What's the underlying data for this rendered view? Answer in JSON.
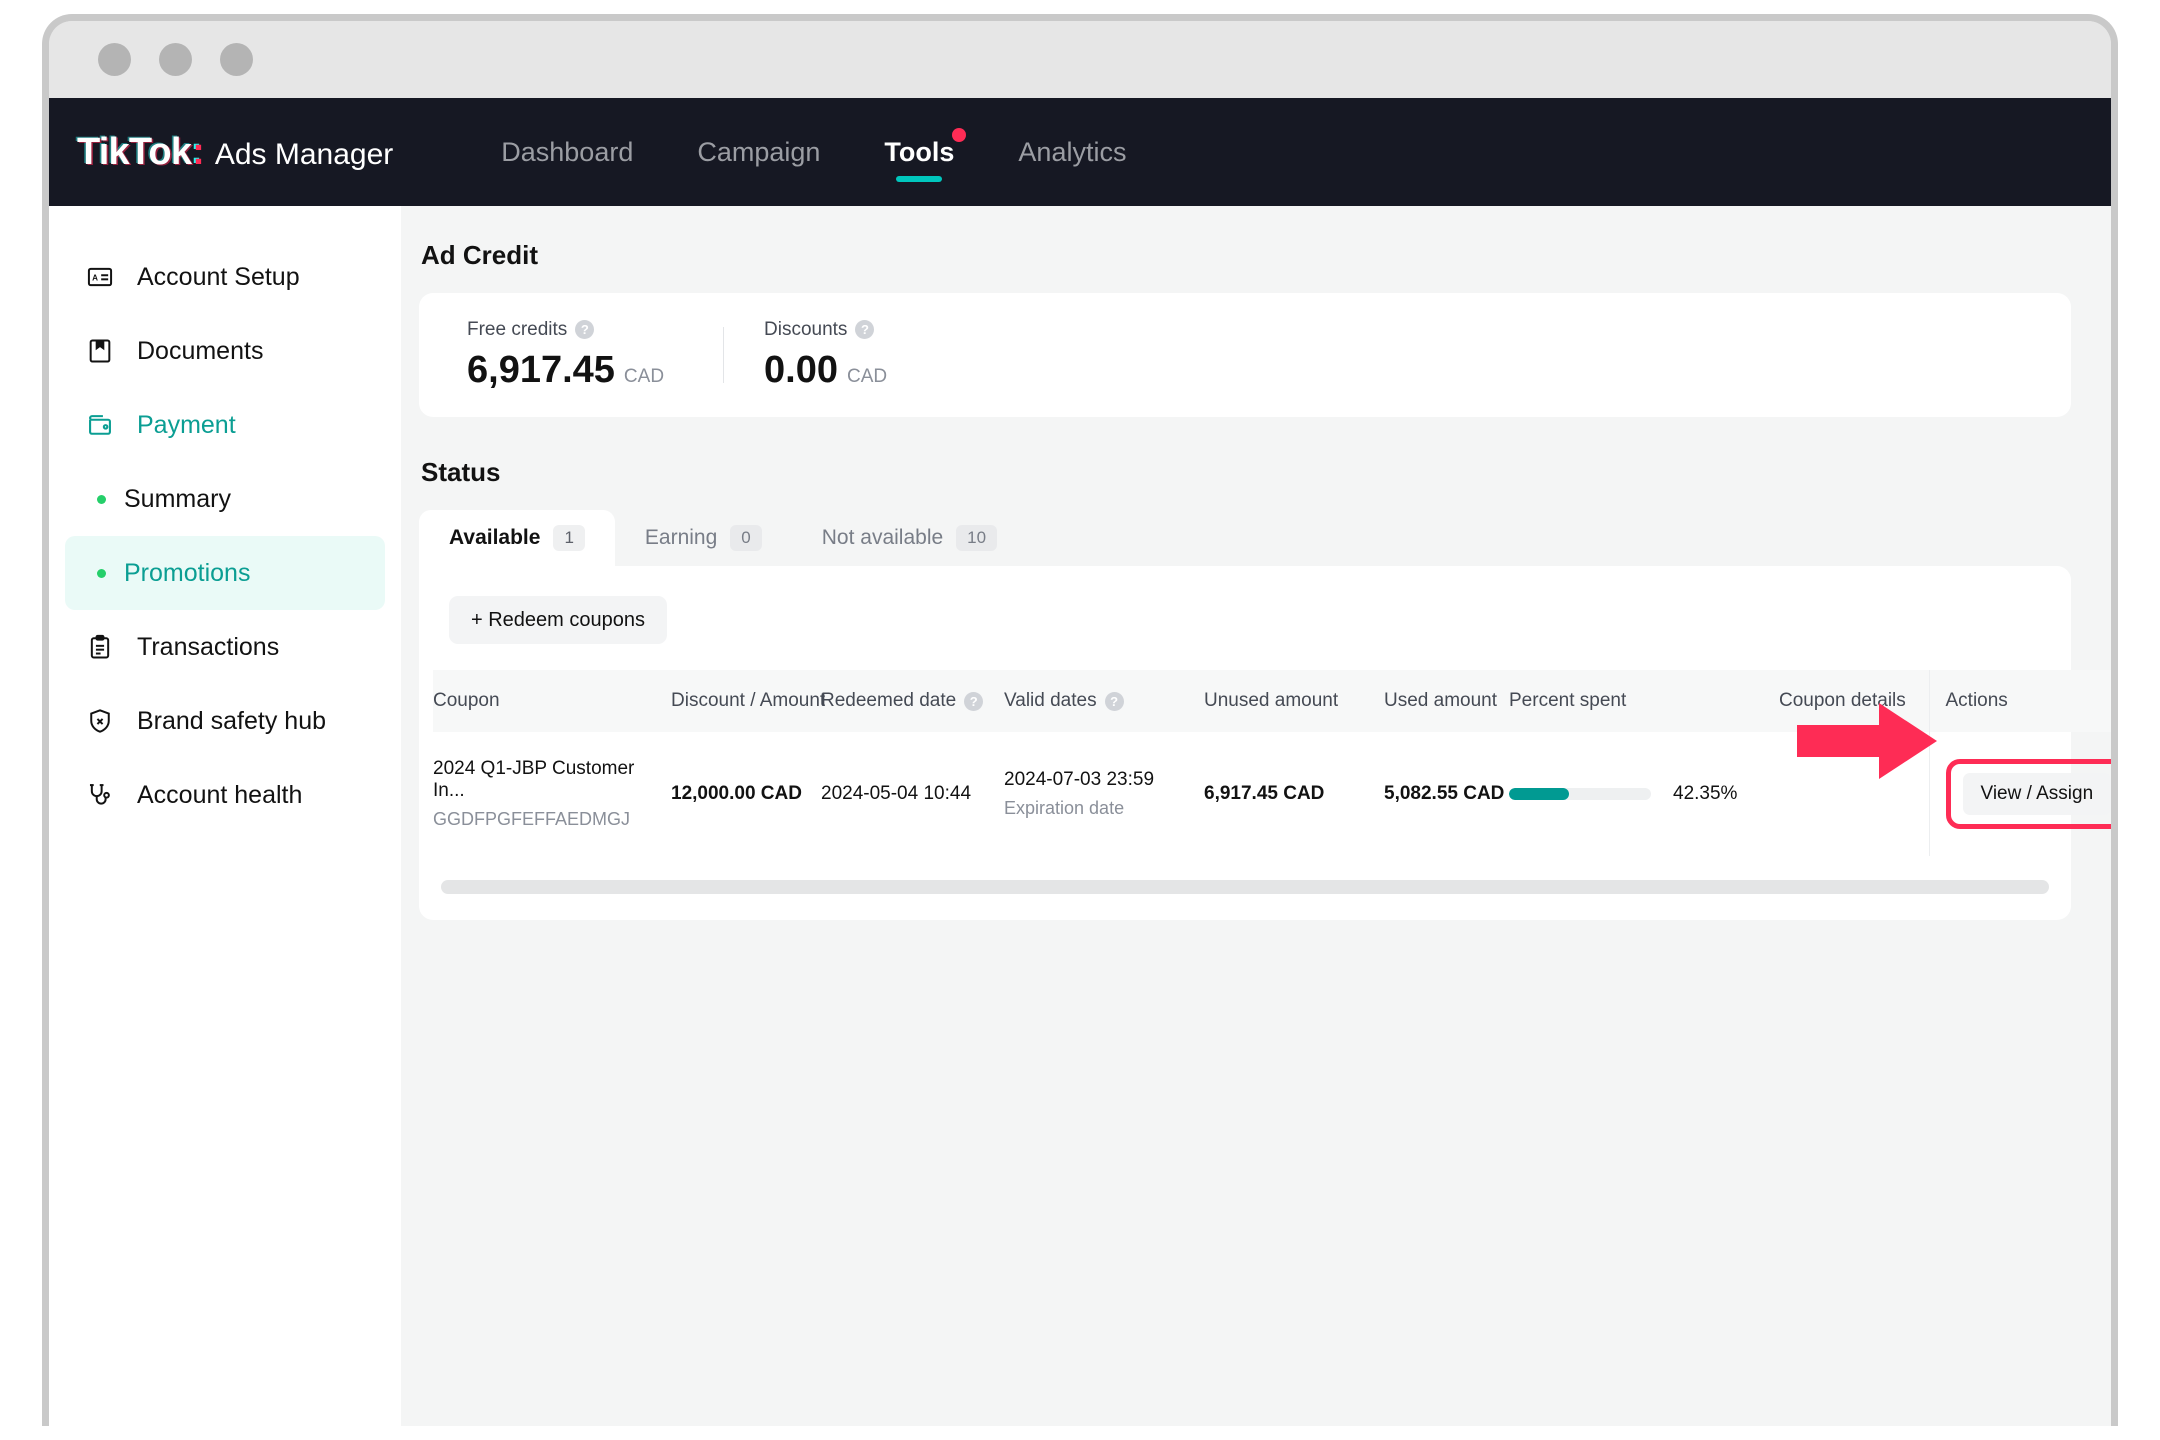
{
  "window": {
    "traffic_lights": [
      "close",
      "minimize",
      "maximize"
    ]
  },
  "brand": {
    "name": "TikTok",
    "colon": ":",
    "product": "Ads Manager"
  },
  "topnav": {
    "items": [
      {
        "label": "Dashboard",
        "active": false,
        "badge": false
      },
      {
        "label": "Campaign",
        "active": false,
        "badge": false
      },
      {
        "label": "Tools",
        "active": true,
        "badge": true
      },
      {
        "label": "Analytics",
        "active": false,
        "badge": false
      }
    ]
  },
  "sidebar": {
    "items": [
      {
        "label": "Account Setup",
        "icon": "id-card-icon",
        "active": false
      },
      {
        "label": "Documents",
        "icon": "bookmark-document-icon",
        "active": false
      },
      {
        "label": "Payment",
        "icon": "wallet-icon",
        "active": true
      },
      {
        "label": "Summary",
        "icon": "bullet-icon",
        "active": false,
        "sub": true
      },
      {
        "label": "Promotions",
        "icon": "bullet-icon",
        "active": true,
        "sub": true
      },
      {
        "label": "Transactions",
        "icon": "clipboard-icon",
        "active": false
      },
      {
        "label": "Brand safety hub",
        "icon": "shield-x-icon",
        "active": false
      },
      {
        "label": "Account health",
        "icon": "stethoscope-icon",
        "active": false
      }
    ]
  },
  "ad_credit": {
    "title": "Ad Credit",
    "free_credits": {
      "label": "Free credits",
      "value": "6,917.45",
      "currency": "CAD"
    },
    "discounts": {
      "label": "Discounts",
      "value": "0.00",
      "currency": "CAD"
    }
  },
  "status": {
    "title": "Status",
    "tabs": [
      {
        "label": "Available",
        "count": "1",
        "active": true
      },
      {
        "label": "Earning",
        "count": "0",
        "active": false
      },
      {
        "label": "Not available",
        "count": "10",
        "active": false
      }
    ],
    "redeem_button": "+ Redeem coupons"
  },
  "table": {
    "columns": [
      {
        "label": "Coupon",
        "help": false
      },
      {
        "label": "Discount / Amount",
        "help": false
      },
      {
        "label": "Redeemed date",
        "help": true
      },
      {
        "label": "Valid dates",
        "help": true
      },
      {
        "label": "Unused amount",
        "help": false
      },
      {
        "label": "Used amount",
        "help": false
      },
      {
        "label": "Percent spent",
        "help": false
      },
      {
        "label": "Coupon details",
        "help": false
      },
      {
        "label": "Actions",
        "help": false
      }
    ],
    "rows": [
      {
        "coupon_name": "2024 Q1-JBP Customer In...",
        "coupon_code": "GGDFPGFEFFAEDMGJ",
        "discount_amount": "12,000.00 CAD",
        "redeemed_date": "2024-05-04 10:44",
        "valid_date": "2024-07-03 23:59",
        "valid_date_sub": "Expiration date",
        "unused_amount": "6,917.45 CAD",
        "used_amount": "5,082.55 CAD",
        "percent_spent": "42.35%",
        "percent_spent_value": 42.35,
        "coupon_details": "",
        "action_label": "View / Assign"
      }
    ]
  },
  "colors": {
    "brand_teal": "#00c6bd",
    "brand_pink": "#fe2c55",
    "nav_background": "#161823",
    "accent_green": "#0b9e93",
    "progress_fill": "#019a92",
    "highlight": "#fe2c55"
  }
}
